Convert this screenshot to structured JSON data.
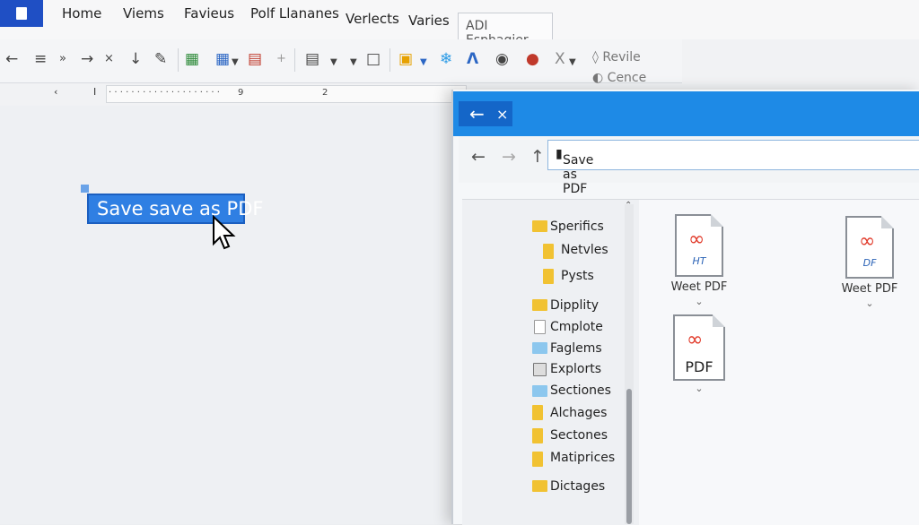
{
  "menu": {
    "items": [
      "Home",
      "Viems",
      "Favieus",
      "Polf Llananes",
      "Verlects",
      "Varies"
    ],
    "active_tab": "ADI Esphagier"
  },
  "toolbar": {
    "revile_label": "Revile",
    "cence_label": "Cence"
  },
  "ruler": {
    "marks": [
      "9",
      "2"
    ]
  },
  "document": {
    "selected_text": "Save save as PDF"
  },
  "dialog": {
    "address": "Save as PDF",
    "folders": [
      "Sperifics",
      "Netvles",
      "Pysts",
      "Dipplity",
      "Cmplote",
      "Faglems",
      "Explorts",
      "Sectiones",
      "Alchages",
      "Sectones",
      "Matiprices",
      "Dictages"
    ],
    "files": [
      {
        "name": "Weet PDF",
        "icon_label": "HT"
      },
      {
        "name": "Weet PDF",
        "icon_label": "DF"
      },
      {
        "name": "",
        "icon_label": "PDF"
      }
    ]
  },
  "colors": {
    "accent": "#1e8ae6",
    "selection": "#2f7fe3",
    "app_icon": "#1f4fc4",
    "pdf_red": "#e13a2a",
    "folder": "#f1c232"
  }
}
